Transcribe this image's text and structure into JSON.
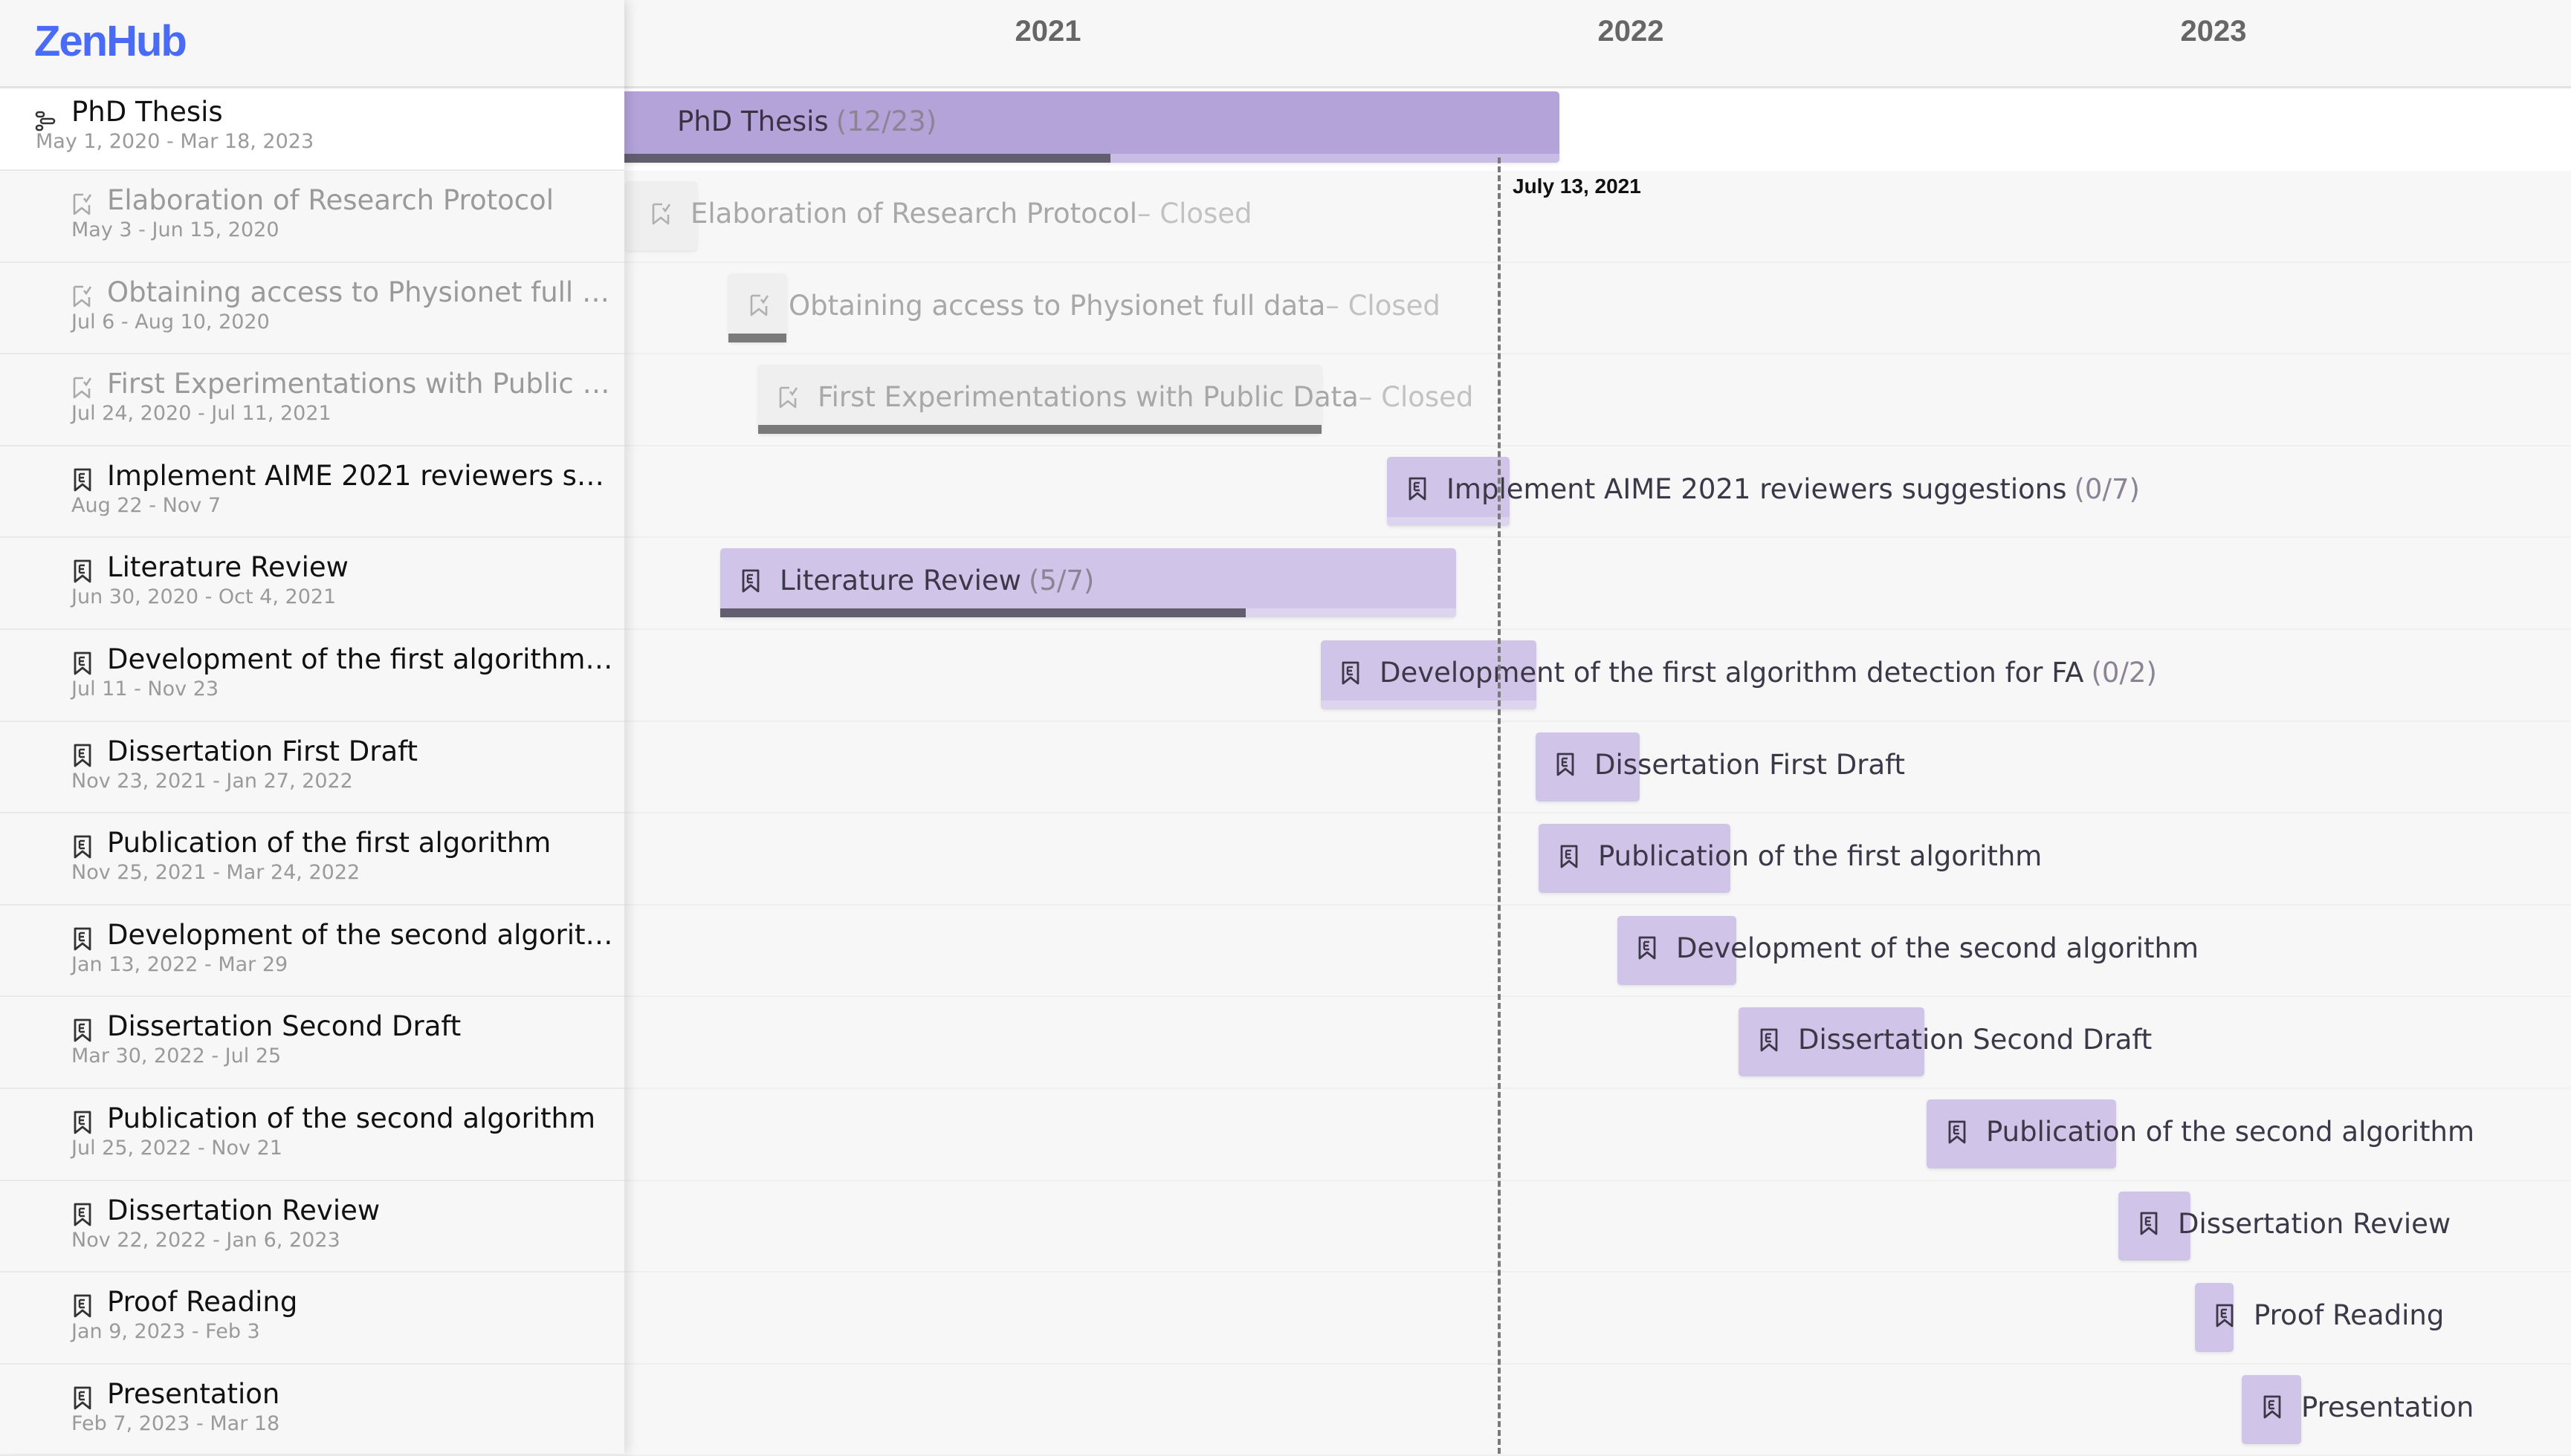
{
  "app": {
    "logo": "ZenHub"
  },
  "timeline": {
    "years": [
      "2021",
      "2022",
      "2023"
    ],
    "today_label": "July 13, 2021"
  },
  "epic": {
    "title": "PhD Thesis",
    "dates": "May 1, 2020 - Mar 18, 2023",
    "count": "(12/23)",
    "progress": 0.52,
    "icon": "roadmap-icon"
  },
  "items": [
    {
      "title": "Elaboration of Research Protocol",
      "sidebar_title": "Elaboration of Research Protocol",
      "dates": "May 3 - Jun 15, 2020",
      "status": "closed",
      "status_text": "– Closed",
      "count": "",
      "icon": "closed-issue-icon",
      "progress": null
    },
    {
      "title": "Obtaining access to Physionet full data",
      "sidebar_title": "Obtaining access to Physionet full da...",
      "dates": "Jul 6 - Aug 10, 2020",
      "status": "closed",
      "status_text": "– Closed",
      "count": "",
      "icon": "closed-issue-icon",
      "progress": 1
    },
    {
      "title": "First Experimentations with Public Data",
      "sidebar_title": "First Experimentations with Public Da...",
      "dates": "Jul 24, 2020 - Jul 11, 2021",
      "status": "closed",
      "status_text": "– Closed",
      "count": "",
      "icon": "closed-issue-icon",
      "progress": 1
    },
    {
      "title": "Implement AIME 2021 reviewers suggestions",
      "sidebar_title": "Implement AIME 2021 reviewers suggest...",
      "dates": "Aug 22 - Nov 7",
      "status": "open",
      "status_text": "",
      "count": "(0/7)",
      "icon": "epic-icon",
      "progress": 0
    },
    {
      "title": "Literature Review",
      "sidebar_title": "Literature Review",
      "dates": "Jun 30, 2020 - Oct 4, 2021",
      "status": "open",
      "status_text": "",
      "count": "(5/7)",
      "icon": "epic-icon",
      "progress": 0.714
    },
    {
      "title": "Development of the first algorithm detection for FA",
      "sidebar_title": "Development of the first algorithm de...",
      "dates": "Jul 11 - Nov 23",
      "status": "open",
      "status_text": "",
      "count": "(0/2)",
      "icon": "epic-icon",
      "progress": 0
    },
    {
      "title": "Dissertation First Draft",
      "sidebar_title": "Dissertation First Draft",
      "dates": "Nov 23, 2021 - Jan 27, 2022",
      "status": "open",
      "status_text": "",
      "count": "",
      "icon": "epic-icon",
      "progress": null
    },
    {
      "title": "Publication of the first algorithm",
      "sidebar_title": "Publication of the first algorithm",
      "dates": "Nov 25, 2021 - Mar 24, 2022",
      "status": "open",
      "status_text": "",
      "count": "",
      "icon": "epic-icon",
      "progress": null
    },
    {
      "title": "Development of the second algorithm",
      "sidebar_title": "Development of the second algorithm",
      "dates": "Jan 13, 2022 - Mar 29",
      "status": "open",
      "status_text": "",
      "count": "",
      "icon": "epic-icon",
      "progress": null
    },
    {
      "title": "Dissertation Second Draft",
      "sidebar_title": "Dissertation Second Draft",
      "dates": "Mar 30, 2022 - Jul 25",
      "status": "open",
      "status_text": "",
      "count": "",
      "icon": "epic-icon",
      "progress": null
    },
    {
      "title": "Publication of the second algorithm",
      "sidebar_title": "Publication of the second algorithm",
      "dates": "Jul 25, 2022 - Nov 21",
      "status": "open",
      "status_text": "",
      "count": "",
      "icon": "epic-icon",
      "progress": null
    },
    {
      "title": "Dissertation Review",
      "sidebar_title": "Dissertation Review",
      "dates": "Nov 22, 2022 - Jan 6, 2023",
      "status": "open",
      "status_text": "",
      "count": "",
      "icon": "epic-icon",
      "progress": null
    },
    {
      "title": "Proof Reading",
      "sidebar_title": "Proof Reading",
      "dates": "Jan 9, 2023 - Feb 3",
      "status": "open",
      "status_text": "",
      "count": "",
      "icon": "epic-icon",
      "progress": null
    },
    {
      "title": "Presentation",
      "sidebar_title": "Presentation",
      "dates": "Feb 7, 2023 - Mar 18",
      "status": "open",
      "status_text": "",
      "count": "",
      "icon": "epic-icon",
      "progress": null
    }
  ],
  "colors": {
    "brand": "#4a6bf5",
    "epic_bar": "#b4a3d9",
    "epic_strip": "#c9bde6",
    "issue_bar": "#d0c5e8",
    "issue_strip": "#ddd4ee",
    "progress": "#625e70",
    "closed_bar": "#efefef",
    "closed_progress": "#7a7a7a"
  }
}
